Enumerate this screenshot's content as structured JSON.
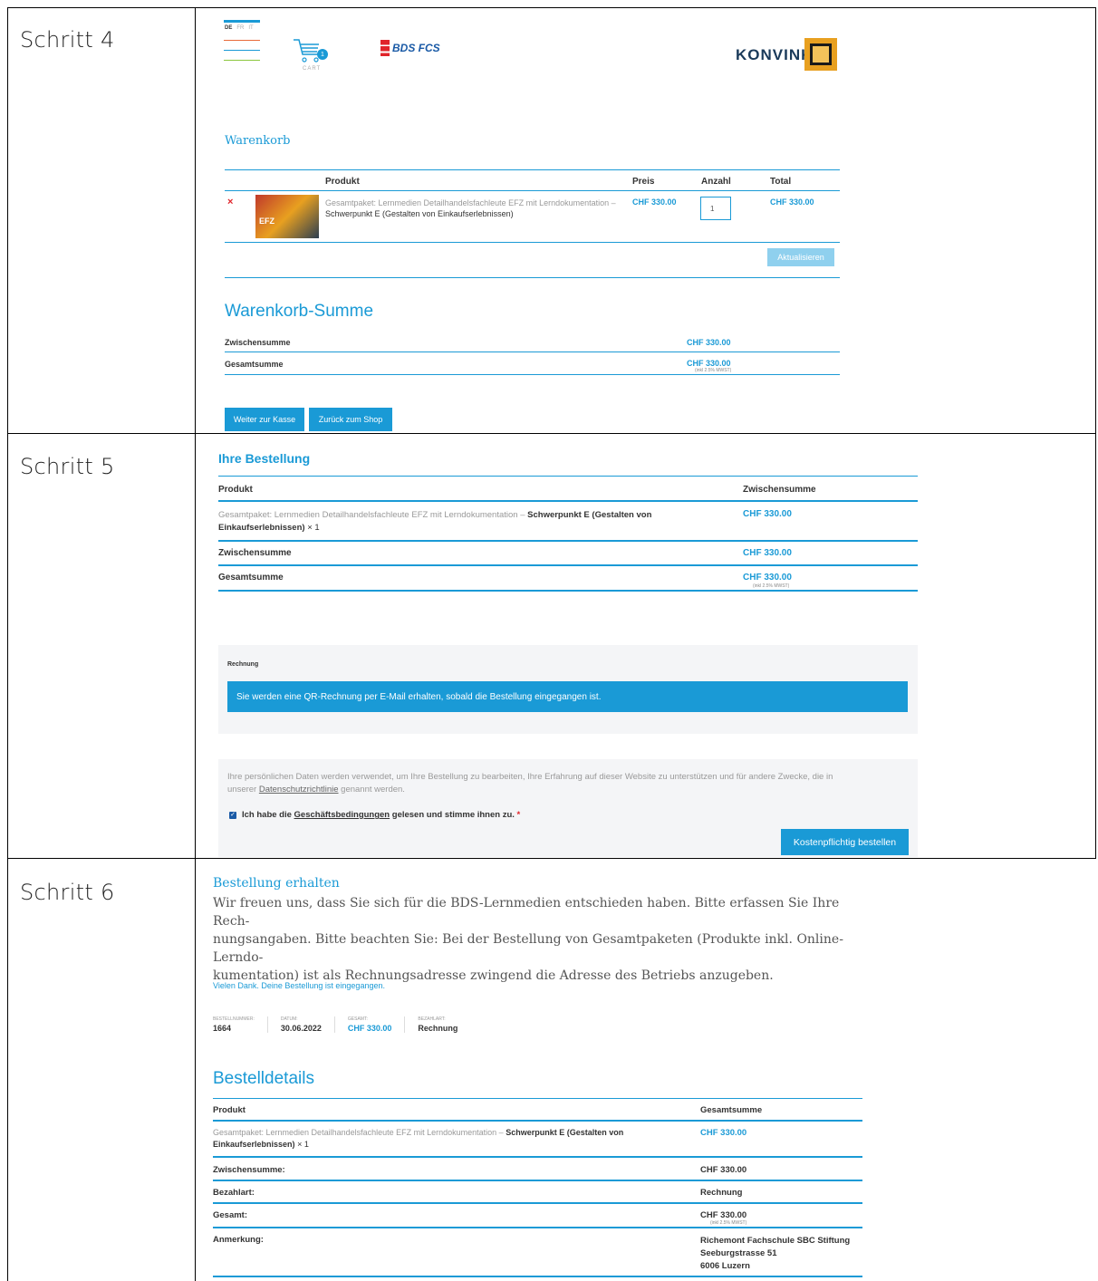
{
  "steps": {
    "s4": "Schritt 4",
    "s5": "Schritt 5",
    "s6": "Schritt 6"
  },
  "step4": {
    "langs": [
      "DE",
      "FR",
      "IT"
    ],
    "cart_label": "CART",
    "cart_count": "1",
    "partner_logo": "BDS FCS",
    "brand_logo": "KONVINK",
    "title": "Warenkorb",
    "headers": {
      "product": "Produkt",
      "price": "Preis",
      "qty": "Anzahl",
      "total": "Total"
    },
    "item": {
      "name_prefix": "Gesamtpaket: Lernmedien Detailhandelsfachleute EFZ mit Lerndokumentation –",
      "name_bold": "Schwerpunkt E (Gestalten von Einkaufserlebnissen)",
      "price": "CHF 330.00",
      "qty": "1",
      "total": "CHF 330.00",
      "thumb_text": "EFZ"
    },
    "update_btn": "Aktualisieren",
    "summary_title": "Warenkorb-Summe",
    "subtotal_label": "Zwischensumme",
    "subtotal_value": "CHF 330.00",
    "total_label": "Gesamtsumme",
    "total_value": "CHF 330.00",
    "vat_note": "(inkl 2.5% MWST)",
    "checkout_btn": "Weiter zur Kasse",
    "back_btn": "Zurück zum Shop"
  },
  "step5": {
    "title": "Ihre Bestellung",
    "headers": {
      "product": "Produkt",
      "subtotal": "Zwischensumme"
    },
    "item_prefix": "Gesamtpaket: Lernmedien Detailhandelsfachleute EFZ mit Lerndokumentation –",
    "item_bold": "Schwerpunkt E (Gestalten von",
    "item_bold2": "Einkaufserlebnissen)",
    "item_qty": "× 1",
    "item_value": "CHF 330.00",
    "subtotal_label": "Zwischensumme",
    "subtotal_value": "CHF 330.00",
    "total_label": "Gesamtsumme",
    "total_value": "CHF 330.00",
    "vat_note": "(inkl 2.5% MWST)",
    "payment_label": "Rechnung",
    "payment_notice": "Sie werden eine QR-Rechnung per E-Mail erhalten, sobald die Bestellung eingegangen ist.",
    "privacy_text_1": "Ihre persönlichen Daten werden verwendet, um Ihre Bestellung zu bearbeiten, Ihre Erfahrung auf dieser Website zu unterstützen und für andere Zwecke, die in",
    "privacy_text_2a": "unserer",
    "privacy_link": "Datenschutzrichtlinie",
    "privacy_text_2b": "genannt werden.",
    "terms_a": "Ich habe die",
    "terms_link": "Geschäftsbedingungen",
    "terms_b": "gelesen und stimme ihnen zu.",
    "required_mark": "*",
    "order_btn": "Kostenpflichtig bestellen"
  },
  "step6": {
    "heading": "Bestellung erhalten",
    "intro_1": "Wir freuen uns, dass Sie sich für die BDS-Lernmedien entschieden haben. Bitte erfassen Sie Ihre Rech-",
    "intro_2": "nungsangaben. Bitte beachten Sie: Bei der Bestellung von Gesamtpaketen (Produkte inkl. Online-Lerndo-",
    "intro_3": "kumentation) ist als Rechnungsadresse zwingend die Adresse des Betriebs anzugeben.",
    "thanks": "Vielen Dank. Deine Bestellung ist eingegangen.",
    "meta": [
      {
        "label": "BESTELLNUMMER:",
        "value": "1664"
      },
      {
        "label": "DATUM:",
        "value": "30.06.2022"
      },
      {
        "label": "GESAMT:",
        "value": "CHF 330.00"
      },
      {
        "label": "BEZAHLART:",
        "value": "Rechnung"
      }
    ],
    "details_title": "Bestelldetails",
    "headers": {
      "product": "Produkt",
      "total": "Gesamtsumme"
    },
    "item_prefix": "Gesamtpaket: Lernmedien Detailhandelsfachleute EFZ mit Lerndokumentation –",
    "item_bold": "Schwerpunkt E (Gestalten von",
    "item_bold2": "Einkaufserlebnissen)",
    "item_qty": "× 1",
    "item_value": "CHF 330.00",
    "rows": [
      {
        "label": "Zwischensumme:",
        "value": "CHF 330.00"
      },
      {
        "label": "Bezahlart:",
        "value": "Rechnung"
      },
      {
        "label": "Gesamt:",
        "value": "CHF 330.00"
      }
    ],
    "vat_note": "(inkl 2.5% MWST)",
    "note_label": "Anmerkung:",
    "note_lines": [
      "Richemont Fachschule SBC Stiftung",
      "Seeburgstrasse 51",
      "6006 Luzern"
    ]
  },
  "colors": {
    "accent": "#1a9ad6",
    "remove": "#e0242a",
    "panel": "#f4f5f7",
    "logo_gold": "#e8a020"
  }
}
